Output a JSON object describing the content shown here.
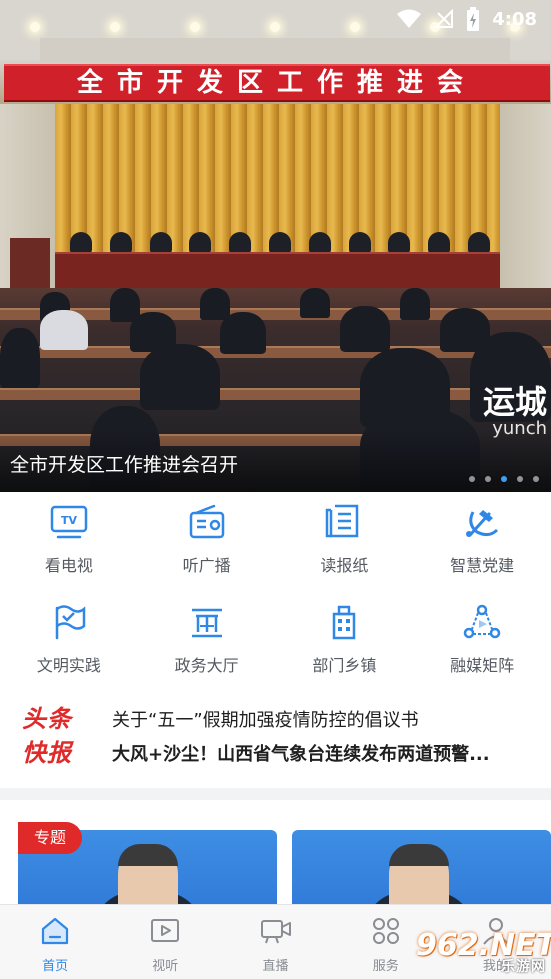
{
  "status_bar": {
    "time": "4:08",
    "icons": [
      "wifi-icon",
      "no-sim-icon",
      "battery-charging-icon"
    ]
  },
  "hero": {
    "banner_text": "全市开发区工作推进会",
    "caption": "全市开发区工作推进会召开",
    "watermark": "运城",
    "watermark_sub": "yunch",
    "slide_count": 5,
    "active_slide": 3,
    "colors": {
      "banner_red": "#d0202a",
      "dot_active": "#3da0f2"
    }
  },
  "grid": {
    "items": [
      {
        "label": "看电视",
        "icon": "tv-icon"
      },
      {
        "label": "听广播",
        "icon": "radio-icon"
      },
      {
        "label": "读报纸",
        "icon": "newspaper-icon"
      },
      {
        "label": "智慧党建",
        "icon": "party-emblem-icon"
      },
      {
        "label": "文明实践",
        "icon": "flag-icon"
      },
      {
        "label": "政务大厅",
        "icon": "government-hall-icon"
      },
      {
        "label": "部门乡镇",
        "icon": "building-icon"
      },
      {
        "label": "融媒矩阵",
        "icon": "media-matrix-icon"
      }
    ],
    "icon_color": "#2f87e6"
  },
  "headlines": {
    "logo_line1": "头条",
    "logo_line2": "快报",
    "items": [
      "关于“五一”假期加强疫情防控的倡议书",
      "大风+沙尘！山西省气象台连续发布两道预警..."
    ]
  },
  "feature": {
    "tag": "专题"
  },
  "bottom_nav": {
    "tabs": [
      {
        "label": "首页",
        "icon": "home-icon",
        "active": true
      },
      {
        "label": "视听",
        "icon": "video-play-icon",
        "active": false
      },
      {
        "label": "直播",
        "icon": "live-camera-icon",
        "active": false
      },
      {
        "label": "服务",
        "icon": "services-grid-icon",
        "active": false
      },
      {
        "label": "我的",
        "icon": "profile-icon",
        "active": false
      }
    ],
    "active_color": "#2f87e6"
  },
  "site_mark": {
    "number": "962.NET",
    "name": "乐游网"
  }
}
